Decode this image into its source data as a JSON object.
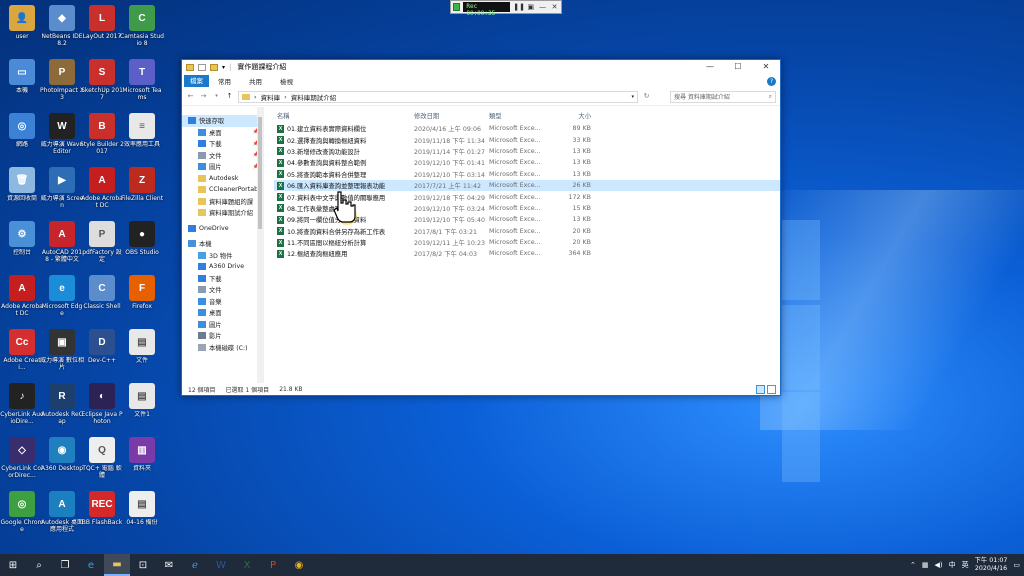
{
  "desktop": {
    "icons": [
      {
        "label": "user",
        "color": "#d9a640",
        "glyph": "👤"
      },
      {
        "label": "NetBeans IDE 8.2",
        "color": "#5b8ccc",
        "glyph": "◆"
      },
      {
        "label": "LayOut 2017",
        "color": "#c9302c",
        "glyph": "L"
      },
      {
        "label": "Camtasia Studio 8",
        "color": "#3f9a4a",
        "glyph": "C"
      },
      {
        "label": "本機",
        "color": "#4a8ad6",
        "glyph": "▭"
      },
      {
        "label": "PhotoImpact X3",
        "color": "#8c6a3a",
        "glyph": "P"
      },
      {
        "label": "SketchUp 2017",
        "color": "#c9302c",
        "glyph": "S"
      },
      {
        "label": "Microsoft Teams",
        "color": "#5b5fc7",
        "glyph": "T"
      },
      {
        "label": "網路",
        "color": "#3b82d6",
        "glyph": "◎"
      },
      {
        "label": "威力導演 WaveEditor",
        "color": "#222222",
        "glyph": "W"
      },
      {
        "label": "Style Builder 2017",
        "color": "#c9302c",
        "glyph": "B"
      },
      {
        "label": "效率應用工具",
        "color": "#e8e8e8",
        "glyph": "≡"
      },
      {
        "label": "資源回收筒",
        "color": "#8db8e0",
        "glyph": "🗑"
      },
      {
        "label": "威力導演 Screen",
        "color": "#2d6db5",
        "glyph": "▶"
      },
      {
        "label": "Adobe Acrobat DC",
        "color": "#c41e1e",
        "glyph": "A"
      },
      {
        "label": "FileZilla Client",
        "color": "#bf2a1e",
        "glyph": "Z"
      },
      {
        "label": "控制台",
        "color": "#4a90d6",
        "glyph": "⚙"
      },
      {
        "label": "AutoCAD 2018 - 繁體中文",
        "color": "#c8242c",
        "glyph": "A"
      },
      {
        "label": "pdfFactory 設定",
        "color": "#dddddd",
        "glyph": "P"
      },
      {
        "label": "OBS Studio",
        "color": "#222222",
        "glyph": "●"
      },
      {
        "label": "Adobe Acrobat DC",
        "color": "#c41e1e",
        "glyph": "A"
      },
      {
        "label": "Microsoft Edge",
        "color": "#1a8cd8",
        "glyph": "e"
      },
      {
        "label": "Classic Shell",
        "color": "#5b8ccc",
        "glyph": "C"
      },
      {
        "label": "Firefox",
        "color": "#e66000",
        "glyph": "F"
      },
      {
        "label": "Adobe Creati...",
        "color": "#d42e2e",
        "glyph": "Cc"
      },
      {
        "label": "威力導演 數位相片",
        "color": "#333333",
        "glyph": "▣"
      },
      {
        "label": "Dev-C++",
        "color": "#2b4f8f",
        "glyph": "D"
      },
      {
        "label": "文件",
        "color": "#e8e8e8",
        "glyph": "▤"
      },
      {
        "label": "CyberLink AudioDire...",
        "color": "#222222",
        "glyph": "♪"
      },
      {
        "label": "Autodesk ReCap",
        "color": "#1c3f6e",
        "glyph": "R"
      },
      {
        "label": "Eclipse Java Photon",
        "color": "#2c2255",
        "glyph": "◐"
      },
      {
        "label": "文件1",
        "color": "#e8e8e8",
        "glyph": "▤"
      },
      {
        "label": "CyberLink ColorDirec...",
        "color": "#3a2d6e",
        "glyph": "◇"
      },
      {
        "label": "A360 Desktop",
        "color": "#1f7fbf",
        "glyph": "◉"
      },
      {
        "label": "TQC+ 電腦 軟體",
        "color": "#eeeeee",
        "glyph": "Q"
      },
      {
        "label": "資料夾",
        "color": "#7a3aa8",
        "glyph": "▥"
      },
      {
        "label": "Google Chrome",
        "color": "#3d9f40",
        "glyph": "◎"
      },
      {
        "label": "Autodesk 桌面應用程式",
        "color": "#1c7fbf",
        "glyph": "A"
      },
      {
        "label": "BB FlashBack",
        "color": "#d62828",
        "glyph": "REC"
      },
      {
        "label": "04-16 備份",
        "color": "#eeeeee",
        "glyph": "▤"
      }
    ]
  },
  "recorder": {
    "time": "Rec 00:00:35"
  },
  "explorer": {
    "title": "實作題課程介紹",
    "window_controls": {
      "minimize": "—",
      "maximize": "☐",
      "close": "✕"
    },
    "ribbon": {
      "file": "檔案",
      "tabs": [
        "常用",
        "共用",
        "檢視"
      ],
      "help": "?"
    },
    "address": {
      "crumbs": [
        "資料庫",
        "資料庫期試介紹"
      ],
      "separator": "›"
    },
    "search_placeholder": "搜尋 資料庫期試介紹",
    "nav": [
      {
        "label": "快速存取",
        "type": "star",
        "sub": false,
        "selected": true
      },
      {
        "label": "桌面",
        "type": "desk",
        "sub": true,
        "pin": true
      },
      {
        "label": "下載",
        "type": "down",
        "sub": true,
        "pin": true
      },
      {
        "label": "文件",
        "type": "doc",
        "sub": true,
        "pin": true
      },
      {
        "label": "圖片",
        "type": "pic",
        "sub": true,
        "pin": true
      },
      {
        "label": "Autodesk",
        "type": "folder",
        "sub": true
      },
      {
        "label": "CCleanerPortable",
        "type": "folder",
        "sub": true
      },
      {
        "label": "資料庫題組的課",
        "type": "folder",
        "sub": true
      },
      {
        "label": "資料庫期試介紹",
        "type": "folder",
        "sub": true
      },
      {
        "label": "OneDrive",
        "type": "cloud",
        "sub": false
      },
      {
        "label": "本機",
        "type": "pc",
        "sub": false
      },
      {
        "label": "3D 物件",
        "type": "3d",
        "sub": true
      },
      {
        "label": "A360 Drive",
        "type": "cloud",
        "sub": true
      },
      {
        "label": "下載",
        "type": "down",
        "sub": true
      },
      {
        "label": "文件",
        "type": "doc",
        "sub": true
      },
      {
        "label": "音樂",
        "type": "music",
        "sub": true
      },
      {
        "label": "桌面",
        "type": "desk",
        "sub": true
      },
      {
        "label": "圖片",
        "type": "pic",
        "sub": true
      },
      {
        "label": "影片",
        "type": "video",
        "sub": true
      },
      {
        "label": "本機磁碟 (C:)",
        "type": "disk",
        "sub": true
      }
    ],
    "columns": {
      "name": "名稱",
      "date": "修改日期",
      "type": "類型",
      "size": "大小"
    },
    "files": [
      {
        "name": "01.建立資料表實際資料欄位",
        "date": "2020/4/16 上午 09:06",
        "type": "Microsoft Exce...",
        "size": "89 KB"
      },
      {
        "name": "02.選擇查詢與轉換樞紐資料",
        "date": "2019/11/18 下午 11:34",
        "type": "Microsoft Exce...",
        "size": "33 KB"
      },
      {
        "name": "03.新增修改查詢功能設計",
        "date": "2019/11/14 下午 01:27",
        "type": "Microsoft Exce...",
        "size": "13 KB"
      },
      {
        "name": "04.參數查詢與資料整合範例",
        "date": "2019/12/10 下午 01:41",
        "type": "Microsoft Exce...",
        "size": "13 KB"
      },
      {
        "name": "05.將查詢範本資料合併整理",
        "date": "2019/12/10 下午 03:14",
        "type": "Microsoft Exce...",
        "size": "13 KB"
      },
      {
        "name": "06.匯入資料庫查詢並整理報表功能",
        "date": "2017/7/21 上午 11:42",
        "type": "Microsoft Exce...",
        "size": "26 KB",
        "selected": true
      },
      {
        "name": "07.資料表中文字與數值的關聯應用",
        "date": "2019/12/18 下午 04:29",
        "type": "Microsoft Exce...",
        "size": "172 KB"
      },
      {
        "name": "08.工作表彙整處理資料",
        "date": "2019/12/10 下午 03:24",
        "type": "Microsoft Exce...",
        "size": "15 KB"
      },
      {
        "name": "09.將同一欄位值分群組資料",
        "date": "2019/12/10 下午 05:40",
        "type": "Microsoft Exce...",
        "size": "13 KB"
      },
      {
        "name": "10.將查詢資料合併另存為新工作表",
        "date": "2017/8/1 下午 03:21",
        "type": "Microsoft Exce...",
        "size": "20 KB"
      },
      {
        "name": "11.不同區間以樞紐分析計算",
        "date": "2019/12/11 上午 10:23",
        "type": "Microsoft Exce...",
        "size": "20 KB"
      },
      {
        "name": "12.樞紐查詢樞紐應用",
        "date": "2017/8/2 下午 04:03",
        "type": "Microsoft Exce...",
        "size": "364 KB"
      }
    ],
    "status": {
      "count": "12 個項目",
      "selection": "已選取 1 個項目",
      "size": "21.8 KB"
    }
  },
  "taskbar": {
    "time": "下午 01:07",
    "date": "2020/4/16",
    "ime": "中",
    "lang": "英",
    "items": [
      {
        "name": "start",
        "glyph": "⊞"
      },
      {
        "name": "search",
        "glyph": "⌕"
      },
      {
        "name": "task-view",
        "glyph": "❐"
      },
      {
        "name": "edge",
        "glyph": "e"
      },
      {
        "name": "file-explorer",
        "glyph": "▬",
        "active": true
      },
      {
        "name": "store",
        "glyph": "⊡"
      },
      {
        "name": "mail",
        "glyph": "✉"
      },
      {
        "name": "ie",
        "glyph": "ℯ"
      },
      {
        "name": "word",
        "glyph": "W"
      },
      {
        "name": "excel",
        "glyph": "X"
      },
      {
        "name": "powerpoint",
        "glyph": "P"
      },
      {
        "name": "chrome",
        "glyph": "◉"
      }
    ]
  }
}
